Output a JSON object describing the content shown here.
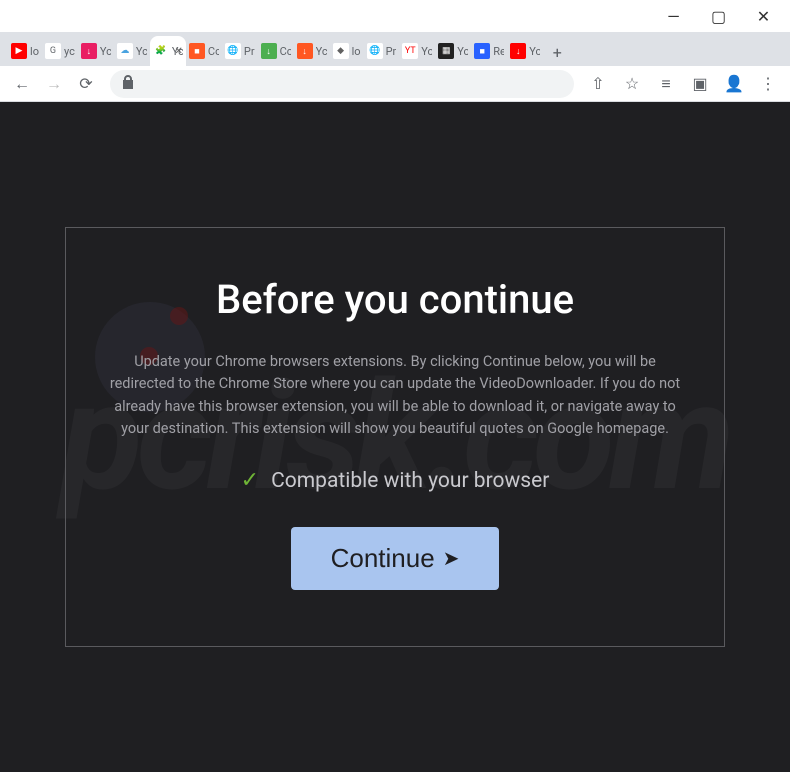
{
  "window": {
    "minimize": "—",
    "maximize": "▢",
    "close": "✕"
  },
  "tabs": [
    {
      "text": "lo",
      "favicon_class": "fav-red",
      "favicon_glyph": "▶"
    },
    {
      "text": "yc",
      "favicon_class": "fav-g",
      "favicon_glyph": "G"
    },
    {
      "text": "Yc",
      "favicon_class": "fav-pink",
      "favicon_glyph": "↓"
    },
    {
      "text": "Yc",
      "favicon_class": "fav-cloud",
      "favicon_glyph": "☁"
    },
    {
      "text": "Yc",
      "favicon_class": "fav-ext",
      "favicon_glyph": "🧩",
      "active": true
    },
    {
      "text": "Cc",
      "favicon_class": "fav-orange",
      "favicon_glyph": "■"
    },
    {
      "text": "Pr",
      "favicon_class": "fav-globe",
      "favicon_glyph": "🌐"
    },
    {
      "text": "Cc",
      "favicon_class": "fav-dl",
      "favicon_glyph": "↓"
    },
    {
      "text": "Yc",
      "favicon_class": "fav-orange",
      "favicon_glyph": "↓"
    },
    {
      "text": "lo",
      "favicon_class": "fav-globe",
      "favicon_glyph": "◆"
    },
    {
      "text": "Pr",
      "favicon_class": "fav-globe",
      "favicon_glyph": "🌐"
    },
    {
      "text": "Yc",
      "favicon_class": "fav-yt",
      "favicon_glyph": "YT"
    },
    {
      "text": "Yc",
      "favicon_class": "fav-dark",
      "favicon_glyph": "▦"
    },
    {
      "text": "Re",
      "favicon_class": "fav-blue",
      "favicon_glyph": "■"
    },
    {
      "text": "Yc",
      "favicon_class": "fav-red",
      "favicon_glyph": "↓"
    }
  ],
  "newtab": "+",
  "toolbar": {
    "back": "←",
    "forward": "→",
    "reload": "⟳",
    "share": "⇧",
    "star": "☆",
    "reading": "≡",
    "panel": "▣",
    "profile": "👤",
    "menu": "⋮"
  },
  "modal": {
    "title": "Before you continue",
    "body": "Update your Chrome browsers extensions. By clicking Continue below, you will be redirected to the Chrome Store where you can update the VideoDownloader. If you do not already have this browser extension, you will be able to download it, or navigate away to your destination. This extension will show you beautiful quotes on Google homepage.",
    "compat_check": "✓",
    "compat_text": "Compatible with your browser",
    "continue_label": "Continue",
    "continue_arrow": "➤"
  },
  "watermark": "pcrisk.com"
}
